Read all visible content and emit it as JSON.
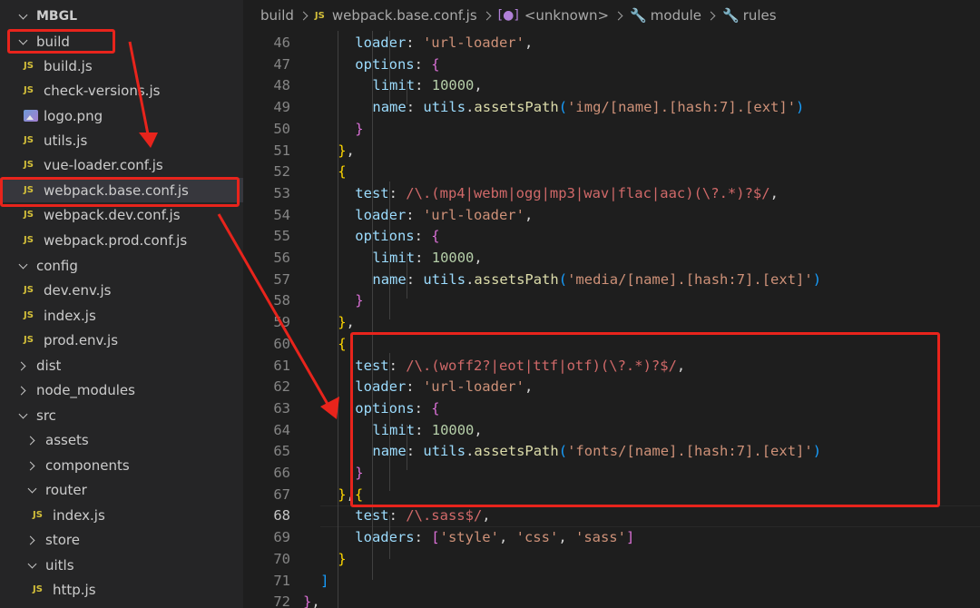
{
  "explorer": {
    "project": "MBGL",
    "rows": [
      {
        "label": "build",
        "kind": "folder-open",
        "depth": 0
      },
      {
        "label": "build.js",
        "kind": "js",
        "depth": 1
      },
      {
        "label": "check-versions.js",
        "kind": "js",
        "depth": 1
      },
      {
        "label": "logo.png",
        "kind": "png",
        "depth": 1
      },
      {
        "label": "utils.js",
        "kind": "js",
        "depth": 1
      },
      {
        "label": "vue-loader.conf.js",
        "kind": "js",
        "depth": 1
      },
      {
        "label": "webpack.base.conf.js",
        "kind": "js",
        "depth": 1,
        "selected": true
      },
      {
        "label": "webpack.dev.conf.js",
        "kind": "js",
        "depth": 1
      },
      {
        "label": "webpack.prod.conf.js",
        "kind": "js",
        "depth": 1
      },
      {
        "label": "config",
        "kind": "folder-open",
        "depth": 0
      },
      {
        "label": "dev.env.js",
        "kind": "js",
        "depth": 1
      },
      {
        "label": "index.js",
        "kind": "js",
        "depth": 1
      },
      {
        "label": "prod.env.js",
        "kind": "js",
        "depth": 1
      },
      {
        "label": "dist",
        "kind": "folder-closed",
        "depth": 0
      },
      {
        "label": "node_modules",
        "kind": "folder-closed",
        "depth": 0
      },
      {
        "label": "src",
        "kind": "folder-open",
        "depth": 0
      },
      {
        "label": "assets",
        "kind": "folder-closed",
        "depth": 1
      },
      {
        "label": "components",
        "kind": "folder-closed",
        "depth": 1
      },
      {
        "label": "router",
        "kind": "folder-open",
        "depth": 1
      },
      {
        "label": "index.js",
        "kind": "js",
        "depth": 2
      },
      {
        "label": "store",
        "kind": "folder-closed",
        "depth": 1
      },
      {
        "label": "uitls",
        "kind": "folder-open",
        "depth": 1
      },
      {
        "label": "http.js",
        "kind": "js",
        "depth": 2
      }
    ]
  },
  "breadcrumb": {
    "folder": "build",
    "file": "webpack.base.conf.js",
    "symbol": "<unknown>",
    "module": "module",
    "rules": "rules",
    "js_badge": "JS"
  },
  "editor": {
    "current_line": 68,
    "lines": [
      {
        "no": 46,
        "indent": 2,
        "tokens": [
          [
            "k",
            "loader"
          ],
          [
            "p",
            ": "
          ],
          [
            "s",
            "'url-loader'"
          ],
          [
            "p",
            ","
          ]
        ]
      },
      {
        "no": 47,
        "indent": 2,
        "tokens": [
          [
            "k",
            "options"
          ],
          [
            "p",
            ": "
          ],
          [
            "b2",
            "{"
          ]
        ]
      },
      {
        "no": 48,
        "indent": 3,
        "tokens": [
          [
            "k",
            "limit"
          ],
          [
            "p",
            ": "
          ],
          [
            "n",
            "10000"
          ],
          [
            "p",
            ","
          ]
        ]
      },
      {
        "no": 49,
        "indent": 3,
        "tokens": [
          [
            "k",
            "name"
          ],
          [
            "p",
            ": "
          ],
          [
            "v",
            "utils"
          ],
          [
            "p",
            "."
          ],
          [
            "f",
            "assetsPath"
          ],
          [
            "b3",
            "("
          ],
          [
            "s",
            "'img/[name].[hash:7].[ext]'"
          ],
          [
            "b3",
            ")"
          ]
        ]
      },
      {
        "no": 50,
        "indent": 2,
        "tokens": [
          [
            "b2",
            "}"
          ]
        ]
      },
      {
        "no": 51,
        "indent": 1,
        "tokens": [
          [
            "b1",
            "}"
          ],
          [
            "p",
            ","
          ]
        ]
      },
      {
        "no": 52,
        "indent": 1,
        "tokens": [
          [
            "b1",
            "{"
          ]
        ]
      },
      {
        "no": 53,
        "indent": 2,
        "tokens": [
          [
            "k",
            "test"
          ],
          [
            "p",
            ": "
          ],
          [
            "r",
            "/\\.(mp4|webm|ogg|mp3|wav|flac|aac)(\\?.*)?$/"
          ],
          [
            "p",
            ","
          ]
        ]
      },
      {
        "no": 54,
        "indent": 2,
        "tokens": [
          [
            "k",
            "loader"
          ],
          [
            "p",
            ": "
          ],
          [
            "s",
            "'url-loader'"
          ],
          [
            "p",
            ","
          ]
        ]
      },
      {
        "no": 55,
        "indent": 2,
        "tokens": [
          [
            "k",
            "options"
          ],
          [
            "p",
            ": "
          ],
          [
            "b2",
            "{"
          ]
        ]
      },
      {
        "no": 56,
        "indent": 3,
        "tokens": [
          [
            "k",
            "limit"
          ],
          [
            "p",
            ": "
          ],
          [
            "n",
            "10000"
          ],
          [
            "p",
            ","
          ]
        ]
      },
      {
        "no": 57,
        "indent": 3,
        "tokens": [
          [
            "k",
            "name"
          ],
          [
            "p",
            ": "
          ],
          [
            "v",
            "utils"
          ],
          [
            "p",
            "."
          ],
          [
            "f",
            "assetsPath"
          ],
          [
            "b3",
            "("
          ],
          [
            "s",
            "'media/[name].[hash:7].[ext]'"
          ],
          [
            "b3",
            ")"
          ]
        ]
      },
      {
        "no": 58,
        "indent": 2,
        "tokens": [
          [
            "b2",
            "}"
          ]
        ]
      },
      {
        "no": 59,
        "indent": 1,
        "tokens": [
          [
            "b1",
            "}"
          ],
          [
            "p",
            ","
          ]
        ]
      },
      {
        "no": 60,
        "indent": 1,
        "tokens": [
          [
            "b1",
            "{"
          ]
        ]
      },
      {
        "no": 61,
        "indent": 2,
        "tokens": [
          [
            "k",
            "test"
          ],
          [
            "p",
            ": "
          ],
          [
            "r",
            "/\\.(woff2?|eot|ttf|otf)(\\?.*)?$/"
          ],
          [
            "p",
            ","
          ]
        ]
      },
      {
        "no": 62,
        "indent": 2,
        "tokens": [
          [
            "k",
            "loader"
          ],
          [
            "p",
            ": "
          ],
          [
            "s",
            "'url-loader'"
          ],
          [
            "p",
            ","
          ]
        ]
      },
      {
        "no": 63,
        "indent": 2,
        "tokens": [
          [
            "k",
            "options"
          ],
          [
            "p",
            ": "
          ],
          [
            "b2",
            "{"
          ]
        ]
      },
      {
        "no": 64,
        "indent": 3,
        "tokens": [
          [
            "k",
            "limit"
          ],
          [
            "p",
            ": "
          ],
          [
            "n",
            "10000"
          ],
          [
            "p",
            ","
          ]
        ]
      },
      {
        "no": 65,
        "indent": 3,
        "tokens": [
          [
            "k",
            "name"
          ],
          [
            "p",
            ": "
          ],
          [
            "v",
            "utils"
          ],
          [
            "p",
            "."
          ],
          [
            "f",
            "assetsPath"
          ],
          [
            "b3",
            "("
          ],
          [
            "s",
            "'fonts/[name].[hash:7].[ext]'"
          ],
          [
            "b3",
            ")"
          ]
        ]
      },
      {
        "no": 66,
        "indent": 2,
        "tokens": [
          [
            "b2",
            "}"
          ]
        ]
      },
      {
        "no": 67,
        "indent": 1,
        "tokens": [
          [
            "b1",
            "}"
          ],
          [
            "p",
            ","
          ],
          [
            "b1",
            "{"
          ]
        ]
      },
      {
        "no": 68,
        "indent": 2,
        "tokens": [
          [
            "k",
            "test"
          ],
          [
            "p",
            ": "
          ],
          [
            "r",
            "/\\.sass$/"
          ],
          [
            "p",
            ","
          ]
        ]
      },
      {
        "no": 69,
        "indent": 2,
        "tokens": [
          [
            "k",
            "loaders"
          ],
          [
            "p",
            ": "
          ],
          [
            "b2",
            "["
          ],
          [
            "s",
            "'style'"
          ],
          [
            "p",
            ", "
          ],
          [
            "s",
            "'css'"
          ],
          [
            "p",
            ", "
          ],
          [
            "s",
            "'sass'"
          ],
          [
            "b2",
            "]"
          ]
        ]
      },
      {
        "no": 70,
        "indent": 1,
        "tokens": [
          [
            "b1",
            "}"
          ]
        ]
      },
      {
        "no": 71,
        "indent": 0,
        "tokens": [
          [
            "b3",
            "]"
          ]
        ]
      },
      {
        "no": 72,
        "indent": -1,
        "tokens": [
          [
            "b2",
            "}"
          ],
          [
            "p",
            ","
          ]
        ]
      }
    ]
  },
  "annotation_color": "#e8241c"
}
